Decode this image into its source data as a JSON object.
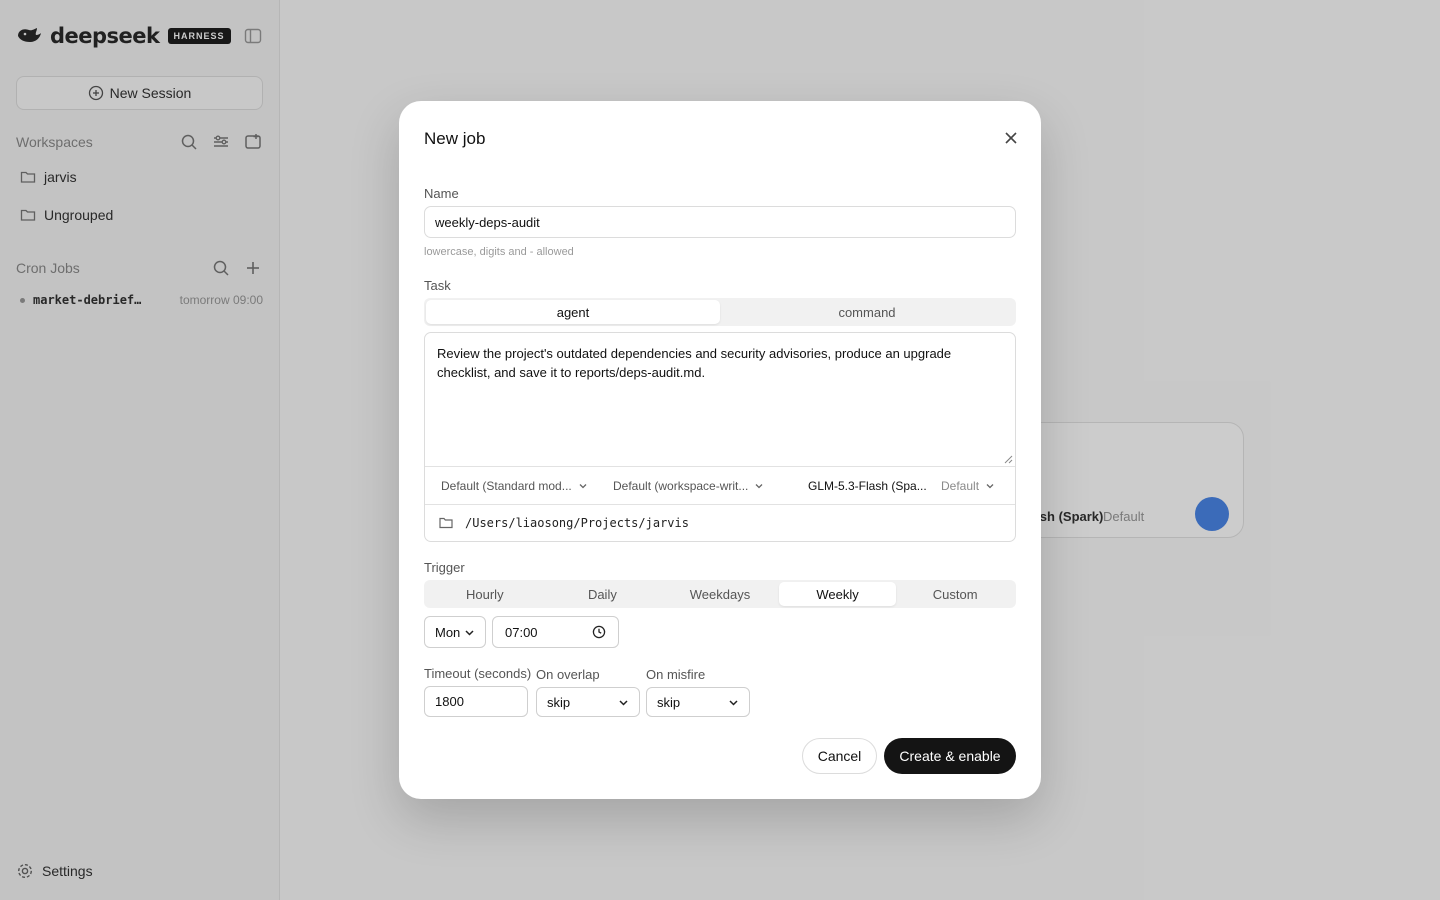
{
  "sidebar": {
    "logo_text": "deepseek",
    "badge": "HARNESS",
    "new_session": "New Session",
    "workspaces_title": "Workspaces",
    "workspaces": [
      {
        "label": "jarvis"
      },
      {
        "label": "Ungrouped"
      }
    ],
    "cron_title": "Cron Jobs",
    "cron_jobs": [
      {
        "name": "market-debrief…",
        "time": "tomorrow 09:00"
      }
    ],
    "settings": "Settings"
  },
  "composer": {
    "model": "Flash (Spark)",
    "default": "Default"
  },
  "modal": {
    "title": "New job",
    "name_label": "Name",
    "name_value": "weekly-deps-audit",
    "name_hint": "lowercase, digits and - allowed",
    "task_label": "Task",
    "task_modes": [
      {
        "label": "agent",
        "active": true
      },
      {
        "label": "command",
        "active": false
      }
    ],
    "task_text": "Review the project's outdated dependencies and security advisories, produce an upgrade checklist, and save it to reports/deps-audit.md.",
    "options": {
      "mode": "Default (Standard mod...",
      "sandbox": "Default (workspace-writ...",
      "model": "GLM-5.3-Flash (Spa...",
      "model_default": "Default"
    },
    "path": "/Users/liaosong/Projects/jarvis",
    "trigger_label": "Trigger",
    "triggers": [
      {
        "label": "Hourly",
        "active": false
      },
      {
        "label": "Daily",
        "active": false
      },
      {
        "label": "Weekdays",
        "active": false
      },
      {
        "label": "Weekly",
        "active": true
      },
      {
        "label": "Custom",
        "active": false
      }
    ],
    "day": "Mon",
    "time": "07:00",
    "timeout_label": "Timeout (seconds)",
    "timeout_value": "1800",
    "overlap_label": "On overlap",
    "overlap_value": "skip",
    "misfire_label": "On misfire",
    "misfire_value": "skip",
    "cancel": "Cancel",
    "create": "Create & enable"
  }
}
